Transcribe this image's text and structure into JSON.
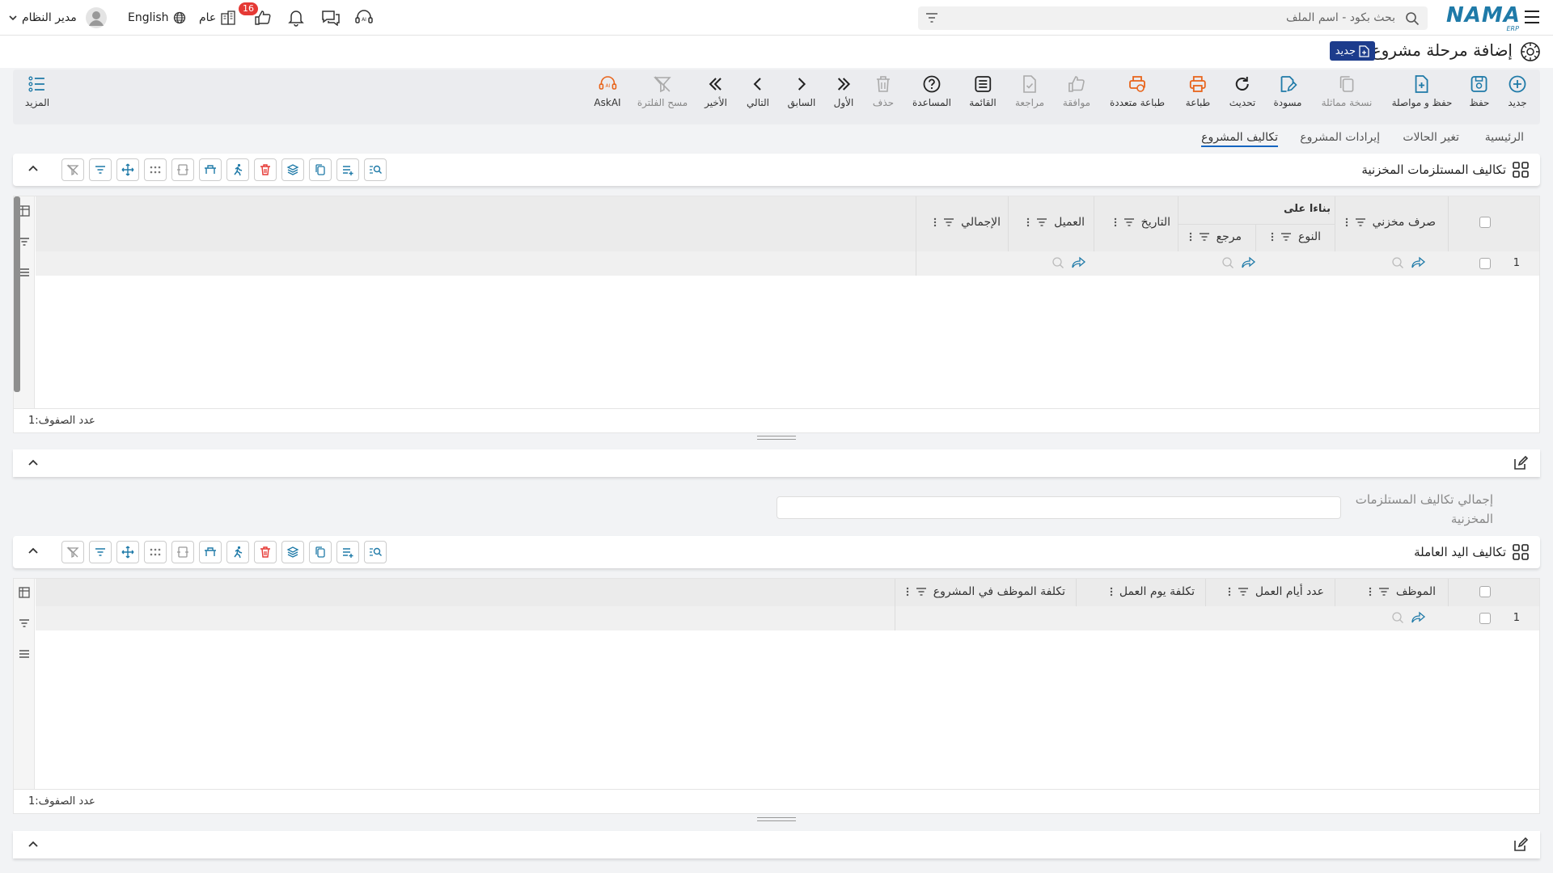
{
  "topbar": {
    "user_name": "مدير النظام",
    "language": "English",
    "scope": "عام",
    "notifications_count": "16",
    "search_placeholder": "بحث بكود - اسم الملف",
    "logo_text": "NAMA",
    "logo_sub": "ERP"
  },
  "page": {
    "title": "إضافة مرحلة مشروع",
    "new_badge": "جديد"
  },
  "toolbar": {
    "new": "جديد",
    "save": "حفظ",
    "save_continue": "حفظ و مواصلة",
    "duplicate": "نسخة مماثلة",
    "draft": "مسودة",
    "refresh": "تحديث",
    "print": "طباعة",
    "multi_print": "طباعة متعددة",
    "approve": "موافقة",
    "review": "مراجعة",
    "list": "القائمة",
    "help": "المساعدة",
    "delete": "حذف",
    "first": "الأول",
    "previous": "السابق",
    "next": "التالي",
    "last": "الأخير",
    "clear_filter": "مسح الفلترة",
    "ask_ai": "AskAI",
    "more": "المزيد"
  },
  "tabs": [
    "الرئيسية",
    "تغير الحالات",
    "إيرادات المشروع",
    "تكاليف المشروع"
  ],
  "stock_section": {
    "title": "تكاليف المستلزمات المخزنية",
    "group_header": "بناءا على",
    "columns": {
      "stock_issue": "صرف مخزني",
      "type": "النوع",
      "reference": "مرجع",
      "date": "التاريخ",
      "customer": "العميل",
      "total": "الإجمالي"
    },
    "rows": [
      {
        "num": "1"
      }
    ],
    "row_count_label": "عدد الصفوف:",
    "row_count": "1"
  },
  "total_field": {
    "label": "إجمالي تكاليف المستلزمات المخزنية",
    "value": ""
  },
  "labor_section": {
    "title": "تكاليف اليد العاملة",
    "columns": {
      "employee": "الموظف",
      "work_days": "عدد أيام العمل",
      "day_cost": "تكلفة يوم العمل",
      "employee_cost": "تكلفة الموظف في المشروع"
    },
    "rows": [
      {
        "num": "1"
      }
    ],
    "row_count_label": "عدد الصفوف:",
    "row_count": "1"
  },
  "colors": {
    "accent": "#1565c0",
    "teal_icon": "#1f7aa8",
    "orange_icon": "#e8641b",
    "red_icon": "#e53935",
    "badge_blue": "#1d3c8c"
  }
}
